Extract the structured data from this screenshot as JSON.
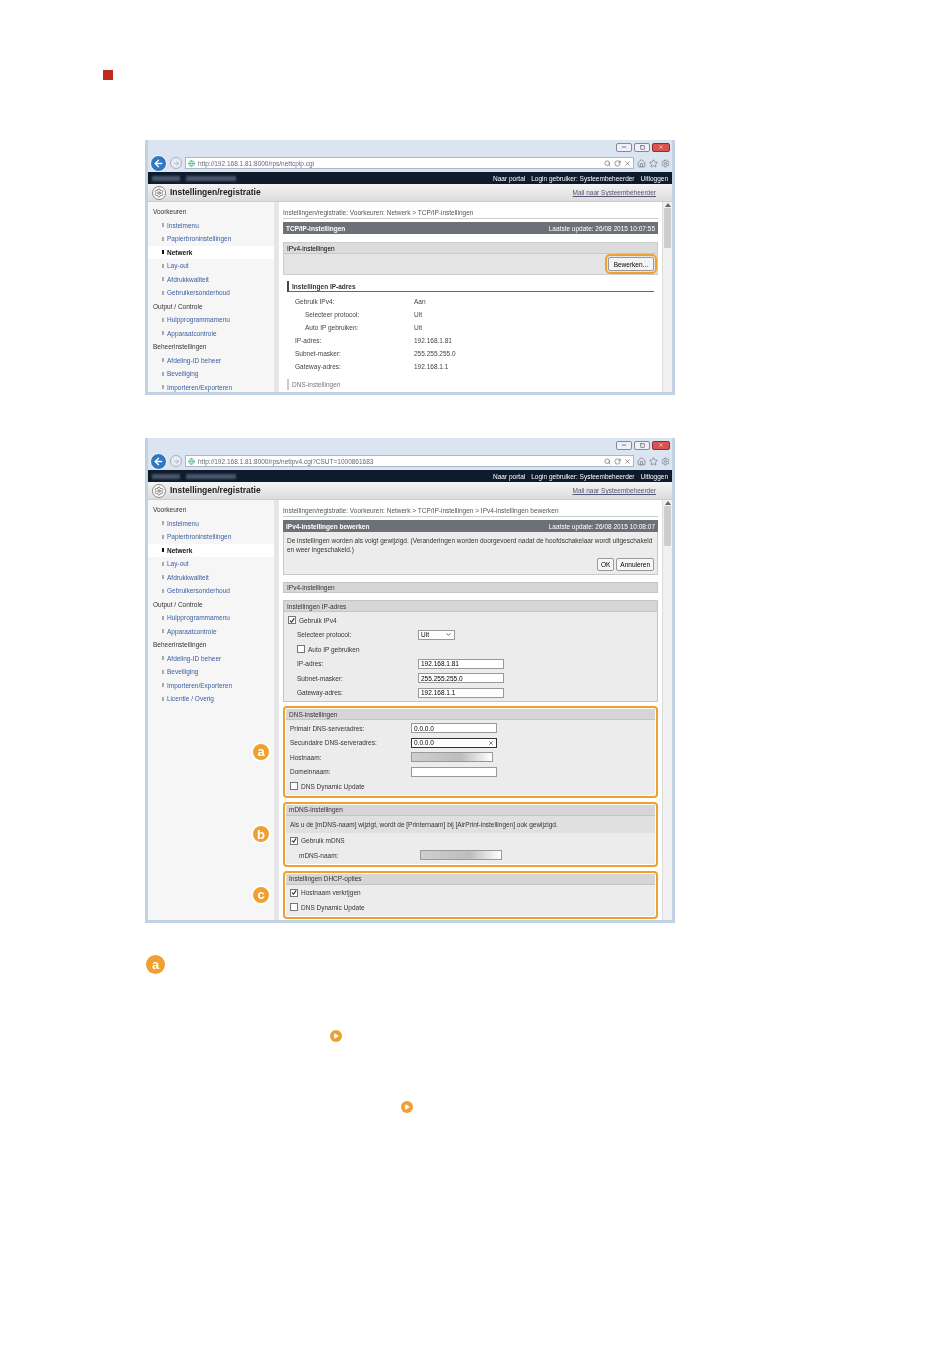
{
  "screenshots": [
    {
      "url": "http://192.168.1.81:8000/rps/nettcpip.cgi",
      "top_links": [
        "Naar portal",
        "Login gebruiker: Systeembeheerder",
        "Uitloggen"
      ],
      "app_title": "Instellingen/registratie",
      "mail_link": "Mail naar Systeembeheerder",
      "sidebar": [
        {
          "label": "Voorkeuren",
          "children": [
            {
              "label": "Instelmenu",
              "selected": false
            },
            {
              "label": "Papierbroninstellingen",
              "selected": false
            },
            {
              "label": "Netwerk",
              "selected": true
            },
            {
              "label": "Lay-out",
              "selected": false
            },
            {
              "label": "Afdrukkwaliteit",
              "selected": false
            },
            {
              "label": "Gebruikersonderhoud",
              "selected": false
            }
          ]
        },
        {
          "label": "Output / Controle",
          "children": [
            {
              "label": "Hulpprogrammamenu",
              "selected": false
            },
            {
              "label": "Apparaatcontrole",
              "selected": false
            }
          ]
        },
        {
          "label": "Beheerinstellingen",
          "children": [
            {
              "label": "Afdeling-ID beheer",
              "selected": false
            },
            {
              "label": "Beveiliging",
              "selected": false
            },
            {
              "label": "Importeren/Exporteren",
              "selected": false
            }
          ]
        }
      ],
      "breadcrumb": "Instellingen/registratie: Voorkeuren: Netwerk > TCP/IP-instellingen",
      "page_title": "TCP/IP-instellingen",
      "last_update": "Laatste update: 26/08 2015 10:07:55",
      "sections": [
        {
          "kind": "button_panel",
          "title": "IPv4-instellingen",
          "button": "Bewerken...",
          "highlighted": true
        },
        {
          "kind": "readonly",
          "title": "Instellingen IP-adres",
          "rows": [
            {
              "label": "Gebruik IPv4:",
              "value": "Aan",
              "children": [
                {
                  "label": "Selecteer protocol:",
                  "value": "Uit"
                },
                {
                  "label": "Auto IP gebruiken:",
                  "value": "Uit"
                }
              ]
            },
            {
              "label": "IP-adres:",
              "value": "192.168.1.81"
            },
            {
              "label": "Subnet-masker:",
              "value": "255.255.255.0"
            },
            {
              "label": "Gateway-adres:",
              "value": "192.168.1.1"
            }
          ]
        },
        {
          "kind": "subheading",
          "title": "DNS-instellingen"
        }
      ]
    },
    {
      "url": "http://192.168.1.81:8000/rps/netipv4.cgi?CSUT=1000861683",
      "top_links": [
        "Naar portal",
        "Login gebruiker: Systeembeheerder",
        "Uitloggen"
      ],
      "app_title": "Instellingen/registratie",
      "mail_link": "Mail naar Systeembeheerder",
      "sidebar": [
        {
          "label": "Voorkeuren",
          "children": [
            {
              "label": "Instelmenu",
              "selected": false
            },
            {
              "label": "Papierbroninstellingen",
              "selected": false
            },
            {
              "label": "Netwerk",
              "selected": true
            },
            {
              "label": "Lay-out",
              "selected": false
            },
            {
              "label": "Afdrukkwaliteit",
              "selected": false
            },
            {
              "label": "Gebruikersonderhoud",
              "selected": false
            }
          ]
        },
        {
          "label": "Output / Controle",
          "children": [
            {
              "label": "Hulpprogrammamenu",
              "selected": false
            },
            {
              "label": "Apparaatcontrole",
              "selected": false
            }
          ]
        },
        {
          "label": "Beheerinstellingen",
          "children": [
            {
              "label": "Afdeling-ID beheer",
              "selected": false
            },
            {
              "label": "Beveiliging",
              "selected": false
            },
            {
              "label": "Importeren/Exporteren",
              "selected": false
            },
            {
              "label": "Licentie / Overig",
              "selected": false
            }
          ]
        }
      ],
      "breadcrumb": "Instellingen/registratie: Voorkeuren: Netwerk > TCP/IP-instellingen > IPv4-instellingen bewerken",
      "page_title": "IPv4-instellingen bewerken",
      "last_update": "Laatste update: 26/08 2015 10:08:07",
      "message": "De instellingen worden als volgt gewijzigd. (Veranderingen worden doorgevoerd nadat de hoofdschakelaar wordt uitgeschakeld en weer ingeschakeld.)",
      "buttons": [
        "OK",
        "Annuleren"
      ],
      "sections": [
        {
          "kind": "heading",
          "title": "IPv4-instellingen"
        },
        {
          "kind": "form",
          "title": "Instellingen IP-adres",
          "rows": [
            {
              "kind": "checkbox",
              "label": "Gebruik IPv4",
              "checked": true,
              "children": [
                {
                  "kind": "select",
                  "label": "Selecteer protocol:",
                  "value": "Uit"
                },
                {
                  "kind": "checkbox",
                  "label": "Auto IP gebruiken",
                  "checked": false
                },
                {
                  "kind": "field",
                  "label": "IP-adres:",
                  "value": "192.168.1.81",
                  "focused": false
                },
                {
                  "kind": "field",
                  "label": "Subnet-masker:",
                  "value": "255.255.255.0",
                  "focused": false
                },
                {
                  "kind": "field",
                  "label": "Gateway-adres:",
                  "value": "192.168.1.1",
                  "focused": false
                }
              ]
            }
          ]
        },
        {
          "kind": "form",
          "title": "DNS-instellingen",
          "marker": "a",
          "rows": [
            {
              "kind": "field",
              "label": "Primair DNS-serveradres:",
              "value": "0.0.0.0",
              "focused": false
            },
            {
              "kind": "field",
              "label": "Secundaire DNS-serveradres:",
              "value": "0.0.0.0",
              "focused": true
            },
            {
              "kind": "hidden_field",
              "label": "Hostnaam:"
            },
            {
              "kind": "field",
              "label": "Domeinnaam:",
              "focused": false
            },
            {
              "kind": "checkbox",
              "label": "DNS Dynamic Update",
              "checked": false
            }
          ]
        },
        {
          "kind": "form",
          "title": "mDNS-instellingen",
          "marker": "b",
          "note": "Als u de [mDNS-naam] wijzigt, wordt de [Printernaam] bij [AirPrint-instellingen] ook gewijzigd.",
          "rows": [
            {
              "kind": "checkbox",
              "label": "Gebruik mDNS",
              "checked": true,
              "children": [
                {
                  "kind": "hidden_field",
                  "label": "mDNS-naam:"
                }
              ]
            }
          ]
        },
        {
          "kind": "form",
          "title": "Instellingen DHCP-opties",
          "marker": "c",
          "rows": [
            {
              "kind": "checkbox",
              "label": "Hostnaam verkrijgen",
              "checked": true
            },
            {
              "kind": "checkbox",
              "label": "DNS Dynamic Update",
              "checked": false
            }
          ]
        }
      ]
    }
  ],
  "callout": {
    "label": "a"
  }
}
